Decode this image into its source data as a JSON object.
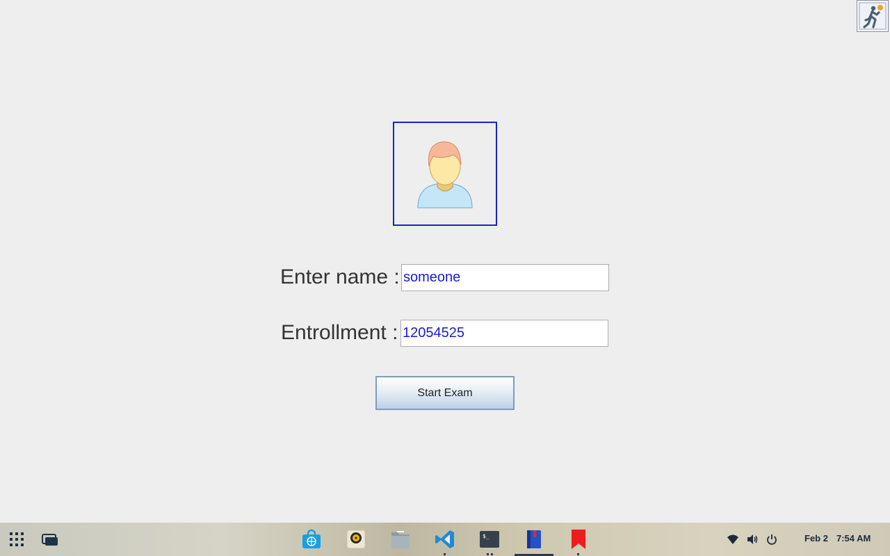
{
  "form": {
    "name_label": "Enter name :",
    "name_value": "someone",
    "enrollment_label": "Entrollment :",
    "enrollment_value": "12054525",
    "start_button_label": "Start Exam"
  },
  "taskbar": {
    "apps": [
      {
        "icon": "app-grid-icon"
      },
      {
        "icon": "window-switcher-icon"
      },
      {
        "icon": "store-bag-icon"
      },
      {
        "icon": "rhythmbox-music-icon"
      },
      {
        "icon": "file-manager-icon"
      },
      {
        "icon": "vscode-icon"
      },
      {
        "icon": "terminal-icon"
      },
      {
        "icon": "notebook-icon",
        "active": true
      },
      {
        "icon": "bookmark-icon"
      }
    ],
    "tray": {
      "icons": [
        "wifi-icon",
        "volume-icon",
        "power-icon"
      ],
      "date": "Feb 2",
      "time": "7:54 AM"
    }
  },
  "colors": {
    "background": "#eeeeee",
    "avatar_border": "#1a22c8",
    "input_text": "#1a1ad0",
    "taskbar_accent": "#253a4f"
  }
}
